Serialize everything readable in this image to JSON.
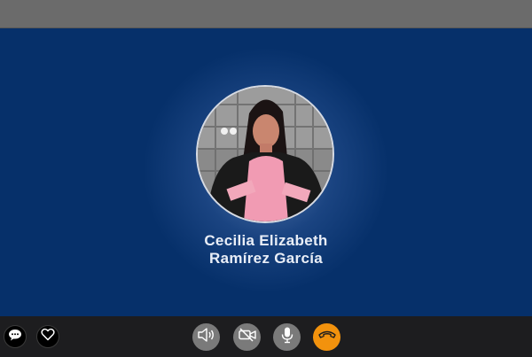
{
  "caller": {
    "name_line1": "Cecilia Elizabeth",
    "name_line2": "Ramírez García"
  },
  "controls": {
    "left": [
      {
        "id": "chat",
        "icon": "chat-bubble-icon"
      },
      {
        "id": "favorite",
        "icon": "heart-icon"
      }
    ],
    "center": [
      {
        "id": "speaker",
        "icon": "speaker-icon"
      },
      {
        "id": "video",
        "icon": "video-off-icon"
      },
      {
        "id": "mute",
        "icon": "microphone-icon"
      },
      {
        "id": "end_call",
        "icon": "hang-up-icon"
      }
    ]
  },
  "colors": {
    "background": "#06306a",
    "top_bar": "#6b6b6b",
    "bottom_bar": "#1d1d1f",
    "control_button": "#7a7a7a",
    "end_call": "#f2920d"
  }
}
